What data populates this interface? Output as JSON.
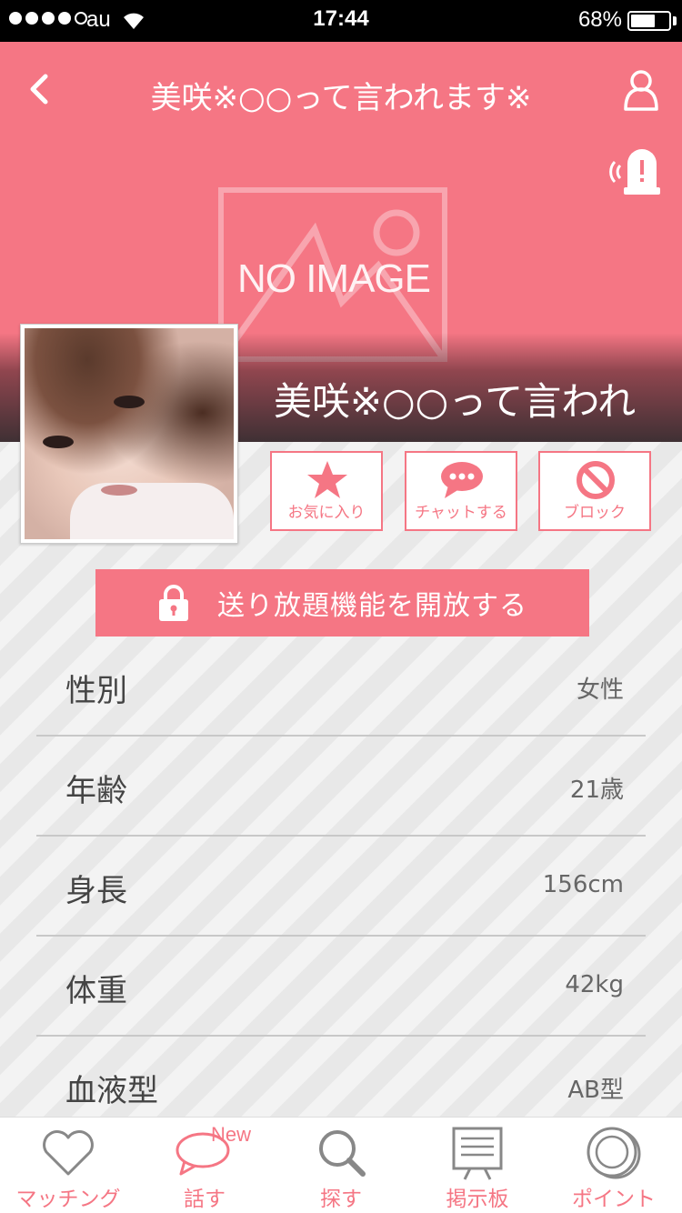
{
  "status_bar": {
    "carrier": "au",
    "time": "17:44",
    "battery_text": "68%",
    "battery_level": 0.68
  },
  "header": {
    "title": "美咲※○○って言われます※"
  },
  "hero": {
    "placeholder_text": "NO IMAGE",
    "name_overlay": "美咲※○○って言われ"
  },
  "actions": {
    "favorite_label": "お気に入り",
    "chat_label": "チャットする",
    "block_label": "ブロック"
  },
  "unlock": {
    "label": "送り放題機能を開放する"
  },
  "profile": {
    "rows": [
      {
        "label": "性別",
        "value": "女性"
      },
      {
        "label": "年齢",
        "value": "21歳"
      },
      {
        "label": "身長",
        "value": "156cm"
      },
      {
        "label": "体重",
        "value": "42kg"
      },
      {
        "label": "血液型",
        "value": "AB型"
      }
    ]
  },
  "tabbar": {
    "items": [
      {
        "label": "マッチング",
        "icon": "heart-icon"
      },
      {
        "label": "話す",
        "icon": "speech-bubble-icon",
        "badge": "New"
      },
      {
        "label": "探す",
        "icon": "search-icon"
      },
      {
        "label": "掲示板",
        "icon": "board-icon"
      },
      {
        "label": "ポイント",
        "icon": "coin-icon"
      }
    ]
  },
  "colors": {
    "accent": "#f57684",
    "background_stripe_light": "#f3f3f3",
    "background_stripe_dark": "#e8e8e8"
  }
}
